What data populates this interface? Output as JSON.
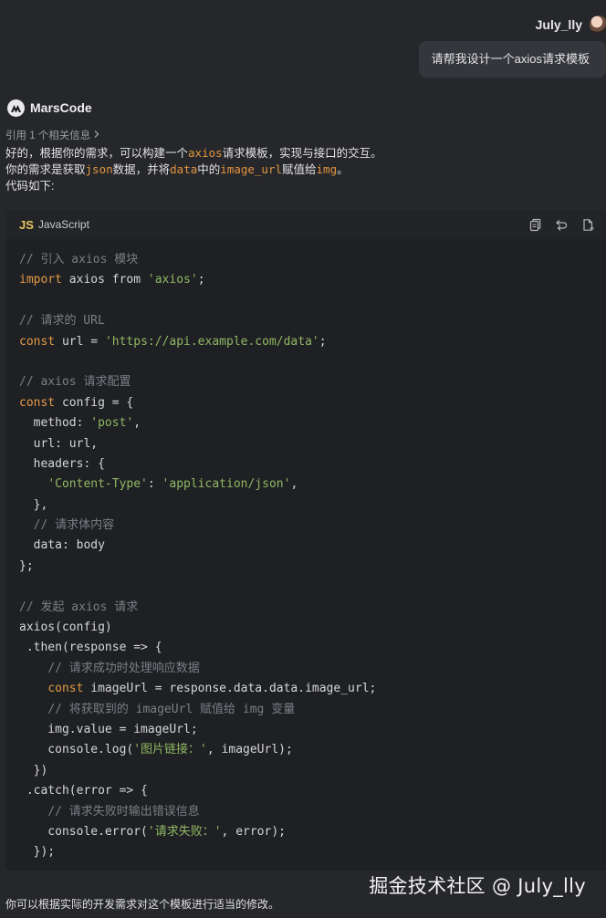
{
  "user": {
    "name": "July_lly",
    "message": "请帮我设计一个axios请求模板"
  },
  "assistant": {
    "name": "MarsCode",
    "reference": "引用 1 个相关信息",
    "intro": [
      [
        {
          "t": "好的，根据你的需求，可以构建一个"
        },
        {
          "t": "axios",
          "code": true
        },
        {
          "t": "请求模板，实现与接口的交互。"
        }
      ],
      [
        {
          "t": "你的需求是获取"
        },
        {
          "t": "json",
          "code": true
        },
        {
          "t": "数据，并将"
        },
        {
          "t": "data",
          "code": true
        },
        {
          "t": "中的"
        },
        {
          "t": "image_url",
          "code": true
        },
        {
          "t": "赋值给"
        },
        {
          "t": "img",
          "code": true
        },
        {
          "t": "。"
        }
      ],
      [
        {
          "t": "代码如下:"
        }
      ]
    ],
    "outro": "你可以根据实际的开发需求对这个模板进行适当的修改。"
  },
  "code_block": {
    "language_icon": "JS",
    "language": "JavaScript",
    "actions": [
      "copy-icon",
      "insert-icon",
      "new-file-icon"
    ],
    "lines": [
      [
        {
          "t": "// 引入 axios 模块",
          "c": "comment"
        }
      ],
      [
        {
          "t": "import",
          "c": "keyword"
        },
        {
          "t": " axios from "
        },
        {
          "t": "'axios'",
          "c": "string"
        },
        {
          "t": ";"
        }
      ],
      [],
      [
        {
          "t": "// 请求的 URL",
          "c": "comment"
        }
      ],
      [
        {
          "t": "const",
          "c": "keyword"
        },
        {
          "t": " url = "
        },
        {
          "t": "'https://api.example.com/data'",
          "c": "string"
        },
        {
          "t": ";"
        }
      ],
      [],
      [
        {
          "t": "// axios 请求配置",
          "c": "comment"
        }
      ],
      [
        {
          "t": "const",
          "c": "keyword"
        },
        {
          "t": " config = {"
        }
      ],
      [
        {
          "t": "  method: "
        },
        {
          "t": "'post'",
          "c": "string"
        },
        {
          "t": ","
        }
      ],
      [
        {
          "t": "  url: url,"
        }
      ],
      [
        {
          "t": "  headers: {"
        }
      ],
      [
        {
          "t": "    "
        },
        {
          "t": "'Content-Type'",
          "c": "string"
        },
        {
          "t": ": "
        },
        {
          "t": "'application/json'",
          "c": "string"
        },
        {
          "t": ","
        }
      ],
      [
        {
          "t": "  },"
        }
      ],
      [
        {
          "t": "  "
        },
        {
          "t": "// 请求体内容",
          "c": "comment"
        }
      ],
      [
        {
          "t": "  data: body"
        }
      ],
      [
        {
          "t": "};"
        }
      ],
      [],
      [
        {
          "t": "// 发起 axios 请求",
          "c": "comment"
        }
      ],
      [
        {
          "t": "axios(config)"
        }
      ],
      [
        {
          "t": " .then(response => {"
        }
      ],
      [
        {
          "t": "    "
        },
        {
          "t": "// 请求成功时处理响应数据",
          "c": "comment"
        }
      ],
      [
        {
          "t": "    "
        },
        {
          "t": "const",
          "c": "keyword"
        },
        {
          "t": " imageUrl = response.data.data.image_url;"
        }
      ],
      [
        {
          "t": "    "
        },
        {
          "t": "// 将获取到的 imageUrl 赋值给 img 变量",
          "c": "comment"
        }
      ],
      [
        {
          "t": "    img.value = imageUrl;"
        }
      ],
      [
        {
          "t": "    console.log("
        },
        {
          "t": "'图片链接：'",
          "c": "string"
        },
        {
          "t": ", imageUrl);"
        }
      ],
      [
        {
          "t": "  })"
        }
      ],
      [
        {
          "t": " .catch(error => {"
        }
      ],
      [
        {
          "t": "    "
        },
        {
          "t": "// 请求失败时输出错误信息",
          "c": "comment"
        }
      ],
      [
        {
          "t": "    console.error("
        },
        {
          "t": "'请求失败：'",
          "c": "string"
        },
        {
          "t": ", error);"
        }
      ],
      [
        {
          "t": "  });"
        }
      ]
    ]
  },
  "watermark": "掘金技术社区 @ July_lly"
}
